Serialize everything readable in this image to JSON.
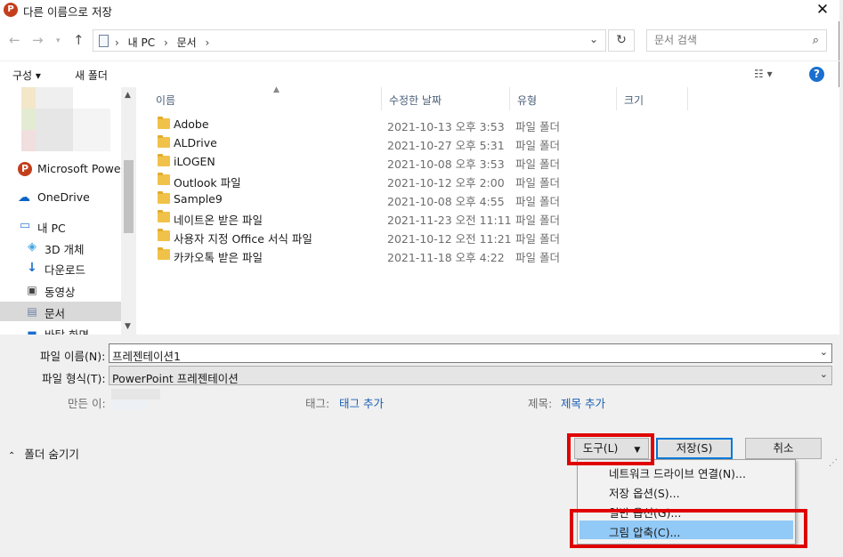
{
  "window": {
    "title": "다른 이름으로 저장",
    "app_icon_letter": "P"
  },
  "address": {
    "crumbs": [
      "내 PC",
      "문서"
    ],
    "separator": "›"
  },
  "search": {
    "placeholder": "문서 검색"
  },
  "commandbar": {
    "organize": "구성 ▾",
    "new_folder": "새 폴더"
  },
  "sidebar": {
    "items": [
      {
        "label": "Microsoft PowerP",
        "icon": "powerpoint-icon"
      },
      {
        "label": "OneDrive",
        "icon": "onedrive-icon"
      },
      {
        "label": "내 PC",
        "icon": "pc-icon"
      },
      {
        "label": "3D 개체",
        "icon": "3d-objects-icon"
      },
      {
        "label": "다운로드",
        "icon": "download-icon"
      },
      {
        "label": "동영상",
        "icon": "video-icon"
      },
      {
        "label": "문서",
        "icon": "document-icon"
      },
      {
        "label": "바탕 화면",
        "icon": "desktop-icon"
      }
    ]
  },
  "columns": {
    "name": "이름",
    "modified": "수정한 날짜",
    "type": "유형",
    "size": "크기"
  },
  "files": [
    {
      "name": "Adobe",
      "date": "2021-10-13 오후 3:53",
      "type": "파일 폴더"
    },
    {
      "name": "ALDrive",
      "date": "2021-10-27 오후 5:31",
      "type": "파일 폴더"
    },
    {
      "name": "iLOGEN",
      "date": "2021-10-08 오후 3:53",
      "type": "파일 폴더"
    },
    {
      "name": "Outlook 파일",
      "date": "2021-10-12 오후 2:00",
      "type": "파일 폴더"
    },
    {
      "name": "Sample9",
      "date": "2021-10-08 오후 4:55",
      "type": "파일 폴더"
    },
    {
      "name": "네이트온 받은 파일",
      "date": "2021-11-23 오전 11:11",
      "type": "파일 폴더"
    },
    {
      "name": "사용자 지정 Office 서식 파일",
      "date": "2021-10-12 오전 11:21",
      "type": "파일 폴더"
    },
    {
      "name": "카카오톡 받은 파일",
      "date": "2021-11-18 오후 4:22",
      "type": "파일 폴더"
    }
  ],
  "form": {
    "filename_label": "파일 이름(N):",
    "filename_value": "프레젠테이션1",
    "filetype_label": "파일 형식(T):",
    "filetype_value": "PowerPoint 프레젠테이션",
    "author_label": "만든 이:",
    "tags_label": "태그:",
    "tags_link": "태그 추가",
    "title_label": "제목:",
    "title_link": "제목 추가"
  },
  "buttons": {
    "hide_folders": "폴더 숨기기",
    "tools": "도구(L)",
    "save": "저장(S)",
    "cancel": "취소"
  },
  "tools_menu": [
    {
      "label": "네트워크 드라이브 연결(N)...",
      "highlighted": false
    },
    {
      "label": "저장 옵션(S)...",
      "highlighted": false
    },
    {
      "label": "일반 옵션(G)...",
      "highlighted": false
    },
    {
      "label": "그림 압축(C)...",
      "highlighted": true
    }
  ],
  "colors": {
    "highlight_box": "#e00000",
    "menu_highlight": "#91c9f7",
    "link": "#1a5fb4"
  }
}
